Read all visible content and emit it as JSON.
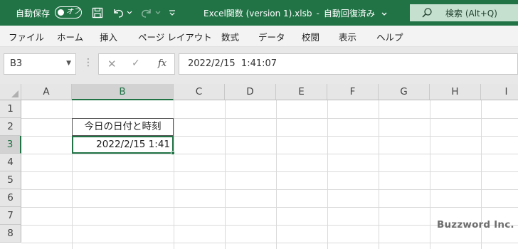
{
  "titlebar": {
    "autosave_label": "自動保存",
    "autosave_state": "オフ",
    "file_name": "Excel関数 (version 1).xlsb",
    "save_status": "自動回復済み",
    "search_label": "検索 (Alt+Q)",
    "accent_color": "#217346"
  },
  "ribbon": {
    "tabs": [
      "ファイル",
      "ホーム",
      "挿入",
      "ページ レイアウト",
      "数式",
      "データ",
      "校閲",
      "表示",
      "ヘルプ"
    ]
  },
  "formula": {
    "name_box": "B3",
    "fx_label": "fx",
    "value": "2022/2/15  1:41:07"
  },
  "sheet": {
    "columns": [
      "A",
      "B",
      "C",
      "D",
      "E",
      "F",
      "G",
      "H",
      "I"
    ],
    "rows": [
      "1",
      "2",
      "3",
      "4",
      "5",
      "6",
      "7",
      "8"
    ],
    "selected_column": "B",
    "selected_row": "3",
    "cells": {
      "B2": "今日の日付と時刻",
      "B3": "2022/2/15 1:41"
    }
  },
  "watermark": "Buzzword Inc."
}
